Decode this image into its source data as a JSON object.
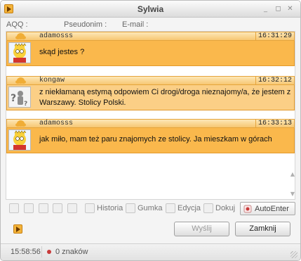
{
  "window": {
    "title": "Sylwia",
    "controls": {
      "minimize": "_",
      "restore": "◻",
      "close": "✕"
    }
  },
  "contact_info": {
    "aqq_label": "AQQ :",
    "pseudonym_label": "Pseudonim :",
    "email_label": "E-mail :"
  },
  "messages": [
    {
      "nick": "adamosss",
      "time": "16:31:29",
      "text": "skąd jestes ?",
      "avatar_icon": "bart-avatar-icon"
    },
    {
      "nick": "kongaw",
      "time": "16:32:12",
      "text": "z niekłamaną estymą odpowiem Ci drogi/droga nieznajomy/a, że jestem z Warszawy. Stolicy Polski.",
      "avatar_icon": "question-avatar-icon"
    },
    {
      "nick": "adamosss",
      "time": "16:33:13",
      "text": "jak miło, mam też paru znajomych ze stolicy. Ja mieszkam w górach",
      "avatar_icon": "bart-avatar-icon"
    }
  ],
  "toolbar": {
    "history_label": "Historia",
    "eraser_label": "Gumka",
    "edit_label": "Edycja",
    "attach_label": "Dokuj",
    "autoenter_label": "AutoEnter"
  },
  "actions": {
    "send_label": "Wyślij",
    "close_label": "Zamknij"
  },
  "statusbar": {
    "time": "15:58:56",
    "chars": "0 znaków"
  },
  "colors": {
    "message_body": "#fab84c",
    "message_header": "#f7c772",
    "status_dot": "#c83a3a"
  }
}
